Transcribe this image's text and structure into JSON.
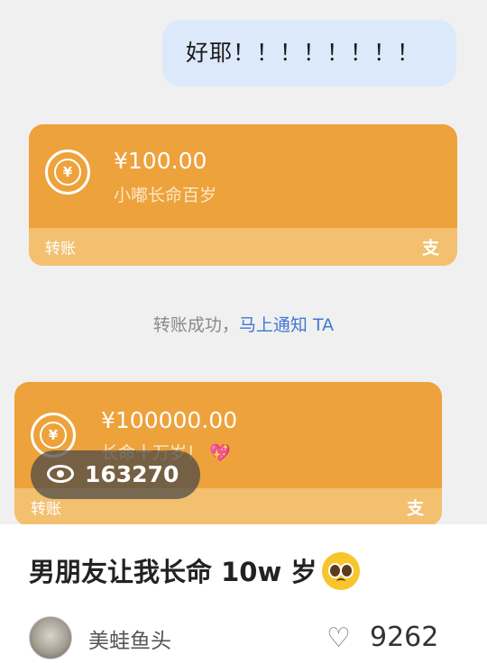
{
  "chat": {
    "bubble_text": "好耶！！！！！！！！",
    "transfer1": {
      "amount": "¥100.00",
      "note": "小嘟长命百岁",
      "footer_label": "转账",
      "footer_icon": "支"
    },
    "notice": {
      "text": "转账成功，",
      "link": "马上通知 TA"
    },
    "transfer2": {
      "amount": "¥100000.00",
      "note": "长命十万岁！",
      "note_emoji": "💖",
      "footer_label": "转账",
      "footer_icon": "支"
    },
    "coin_symbol": "¥"
  },
  "overlay": {
    "views": "163270",
    "icon": "eye-icon"
  },
  "post": {
    "title": "男朋友让我长命 10w 岁",
    "emoji": "pleading-face-icon",
    "author": "美蛙鱼头",
    "likes": "9262",
    "like_icon": "heart-outline-icon"
  },
  "colors": {
    "card_orange": "#eda23b",
    "card_footer": "#f3c070",
    "bubble_blue": "#dbe9fb",
    "link_blue": "#3f78d1"
  }
}
